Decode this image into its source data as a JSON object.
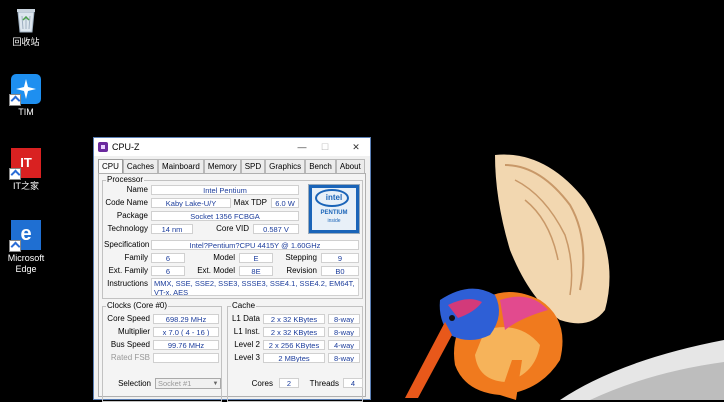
{
  "desktop": {
    "icons": [
      {
        "label": "回收站",
        "icon": "recycle-bin-icon"
      },
      {
        "label": "TIM",
        "icon": "tim-icon"
      },
      {
        "label": "IT之家",
        "icon": "ithome-icon",
        "badge": "IT"
      },
      {
        "label": "Microsoft\nEdge",
        "icon": "edge-icon",
        "badge": "e"
      }
    ]
  },
  "window": {
    "title": "CPU-Z",
    "buttons": {
      "minimize": "—",
      "maximize": "☐",
      "close": "✕"
    },
    "tabs": [
      "CPU",
      "Caches",
      "Mainboard",
      "Memory",
      "SPD",
      "Graphics",
      "Bench",
      "About"
    ],
    "active_tab": "CPU",
    "processor": {
      "legend": "Processor",
      "name_label": "Name",
      "name": "Intel Pentium",
      "codename_label": "Code Name",
      "codename": "Kaby Lake-U/Y",
      "maxtdp_label": "Max TDP",
      "maxtdp": "6.0 W",
      "package_label": "Package",
      "package": "Socket 1356 FCBGA",
      "technology_label": "Technology",
      "technology": "14 nm",
      "corevid_label": "Core VID",
      "corevid": "0.587 V",
      "spec_label": "Specification",
      "spec": "Intel?Pentium?CPU 4415Y @ 1.60GHz",
      "family_label": "Family",
      "family": "6",
      "model_label": "Model",
      "model": "E",
      "stepping_label": "Stepping",
      "stepping": "9",
      "extfamily_label": "Ext. Family",
      "extfamily": "6",
      "extmodel_label": "Ext. Model",
      "extmodel": "8E",
      "revision_label": "Revision",
      "revision": "B0",
      "instructions_label": "Instructions",
      "instructions": "MMX, SSE, SSE2, SSE3, SSSE3, SSE4.1, SSE4.2, EM64T, VT-x, AES",
      "logo": {
        "brand": "intel",
        "line": "PENTIUM",
        "sub": "inside"
      }
    },
    "clocks": {
      "legend": "Clocks (Core #0)",
      "corespeed_label": "Core Speed",
      "corespeed": "698.29 MHz",
      "multiplier_label": "Multiplier",
      "multiplier": "x 7.0 ( 4 - 16 )",
      "busspeed_label": "Bus Speed",
      "busspeed": "99.76 MHz",
      "ratedfsb_label": "Rated FSB",
      "ratedfsb": ""
    },
    "cache": {
      "legend": "Cache",
      "rows": [
        {
          "label": "L1 Data",
          "size": "2 x 32 KBytes",
          "way": "8-way"
        },
        {
          "label": "L1 Inst.",
          "size": "2 x 32 KBytes",
          "way": "8-way"
        },
        {
          "label": "Level 2",
          "size": "2 x 256 KBytes",
          "way": "4-way"
        },
        {
          "label": "Level 3",
          "size": "2 MBytes",
          "way": "8-way"
        }
      ]
    },
    "footer": {
      "selection_label": "Selection",
      "selection": "Socket #1",
      "cores_label": "Cores",
      "cores": "2",
      "threads_label": "Threads",
      "threads": "4"
    }
  },
  "colors": {
    "value_text": "#1c3d9c",
    "bird_orange": "#f07a1e",
    "bird_blue": "#2e5fd6"
  }
}
